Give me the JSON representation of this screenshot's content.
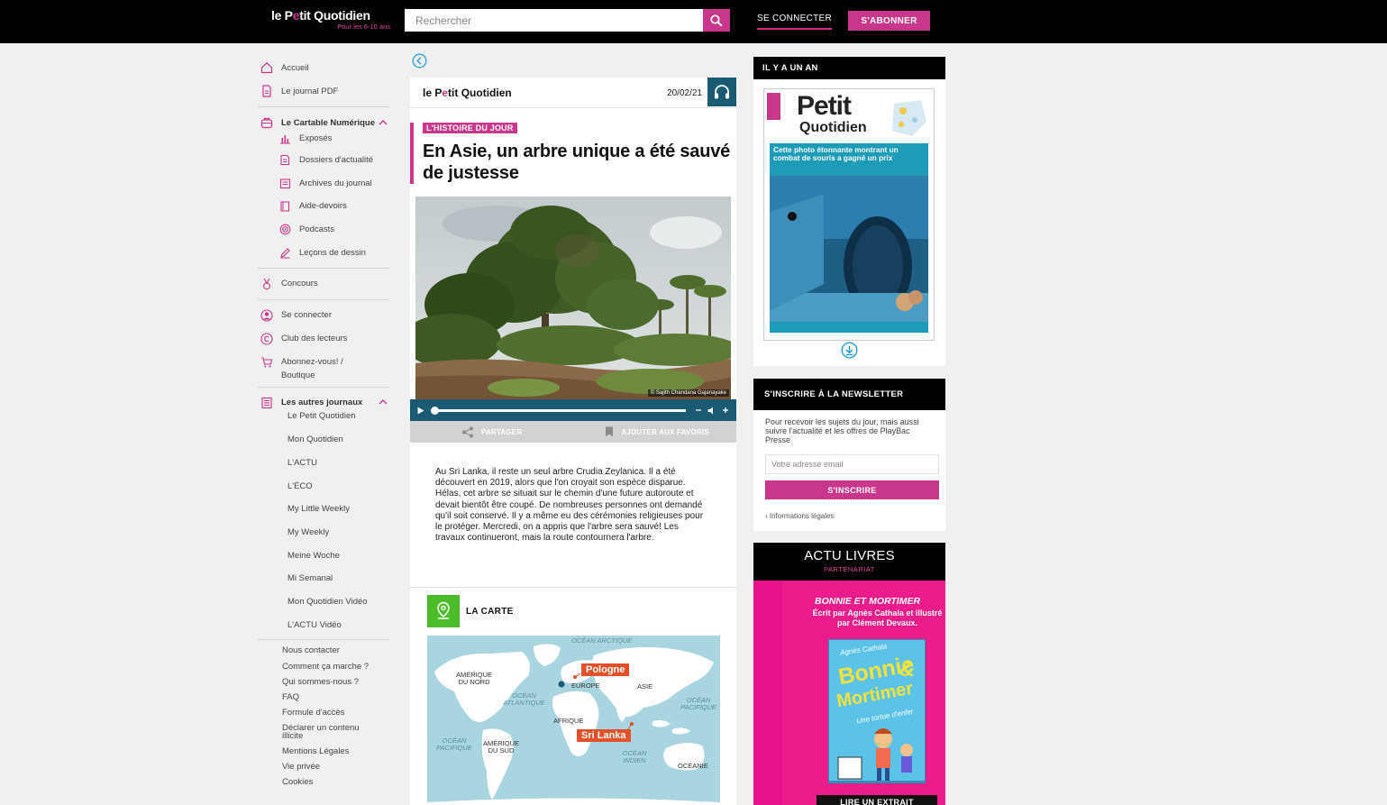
{
  "header": {
    "logo_title_a": "le P",
    "logo_title_b": "e",
    "logo_title_c": "tit Quotidien",
    "logo_sub": "Pour les 6-10 ans",
    "search_placeholder": "Rechercher",
    "login": "SE CONNECTER",
    "subscribe": "S'ABONNER"
  },
  "sidebar": {
    "home": "Accueil",
    "pdf": "Le journal PDF",
    "cartable": {
      "label": "Le Cartable Numérique",
      "items": [
        "Exposés",
        "Dossiers d'actualité",
        "Archives du journal",
        "Aide-devoirs",
        "Podcasts",
        "Leçons de dessin"
      ]
    },
    "contest": "Concours",
    "login": "Se connecter",
    "club": "Club des lecteurs",
    "shop_line1": "Abonnez-vous! /",
    "shop_line2": "Boutique",
    "journals": {
      "label": "Les autres journaux",
      "items": [
        "Le Petit Quotidien",
        "Mon Quotidien",
        "L'ACTU",
        "L'ÉCO",
        "My Little Weekly",
        "My Weekly",
        "Meine Woche",
        "Mi Semanal",
        "Mon Quotidien Vidéo",
        "L'ACTU Vidéo"
      ]
    },
    "footer": [
      "Nous contacter",
      "Comment ça marche ?",
      "Qui sommes-nous ?",
      "FAQ",
      "Formule d'accès",
      "Déclarer un contenu illicite",
      "Mentions Légales",
      "Vie privée",
      "Cookies"
    ]
  },
  "article": {
    "brand_a": "le P",
    "brand_b": "e",
    "brand_c": "tit Quotidien",
    "date": "20/02/21",
    "rubric": "L'HISTOIRE DU JOUR",
    "title": "En Asie, un arbre unique a été sauvé de justesse",
    "photo_credit": "© Sajith Chandana Gajanayake",
    "share": "PARTAGER",
    "favorite": "AJOUTER AUX FAVORIS",
    "body": "Au Sri Lanka, il reste un seul arbre Crudia Zeylanica. Il a été découvert en 2019, alors que l'on croyait son espèce disparue. Hélas, cet arbre se situait sur le chemin d'une future autoroute et devait bientôt être coupé. De nombreuses personnes ont demandé qu'il soit conservé. Il y a même eu des cérémonies religieuses pour le protéger. Mercredi, on a appris que l'arbre sera sauvé! Les travaux continueront, mais la route contournera l'arbre.",
    "map_label": "LA CARTE",
    "map": {
      "ocean_arctic": "OCÉAN ARCTIQUE",
      "north_america": "AMÉRIQUE DU NORD",
      "atlantic": "OCÉAN ATLANTIQUE",
      "europe": "EUROPE",
      "asia": "ASIE",
      "pacific_east": "OCÉAN PACIFIQUE",
      "africa": "AFRIQUE",
      "pacific_west": "OCÉAN PACIFIQUE",
      "south_america": "AMÉRIQUE DU SUD",
      "indian": "OCÉAN INDIEN",
      "oceania": "OCÉANIE",
      "tag_poland": "Pologne",
      "tag_srilanka": "Sri Lanka"
    }
  },
  "right": {
    "year_ago": "IL Y A UN AN",
    "cover": {
      "name_a": "Petit",
      "name_b": "Quotidien",
      "headline": "Cette photo étonnante montrant un combat de souris a gagné un prix"
    },
    "newsletter": {
      "title": "S'INSCRIRE À LA NEWSLETTER",
      "text": "Pour recevoir les sujets du jour, mais aussi suivre l'actualité et les offres de PlayBac Presse",
      "placeholder": "Votre adresse email",
      "button": "S'INSCRIRE",
      "legal": "Informations légales"
    },
    "books": {
      "title": "ACTU LIVRES",
      "sub": "PARTENARIAT",
      "book_title": "BONNIE ET MORTIMER",
      "book_line1": "Écrit par Agnès Cathala et illustré",
      "book_line2": "par Clément Devaux.",
      "cover_author": "Agnès Cathala",
      "cover_title_1": "Bonnie",
      "cover_title_2": "&",
      "cover_title_3": "Mortimer",
      "cover_subtitle": "Une tortue d'enfer",
      "extract": "LIRE UN EXTRAIT"
    }
  },
  "colors": {
    "brand": "#c9378d",
    "audio": "#1a5a72",
    "map_green": "#4cbd28",
    "tag_orange": "#e3502a",
    "books_pink": "#ec1c8c"
  }
}
